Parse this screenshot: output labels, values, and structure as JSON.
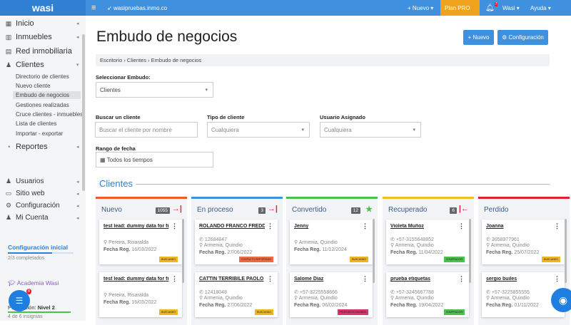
{
  "topbar": {
    "logo": "wasi",
    "menu_icon": "hamburger-icon",
    "site": "wasipruebas.inmo.co",
    "nuevo": "+ Nuevo ▾",
    "plan": "Plan PRO",
    "notif_count": "7",
    "user": "Wasi ▾",
    "help": "Ayuda ▾"
  },
  "sidebar": {
    "items": [
      {
        "label": "Inicio",
        "icon": "▦"
      },
      {
        "label": "Inmuebles",
        "icon": "▥"
      },
      {
        "label": "Red inmobiliaria",
        "icon": "▤"
      },
      {
        "label": "Clientes",
        "icon": "👥"
      }
    ],
    "sub": [
      "Directorio de clientes",
      "Nuevo cliente",
      "Embudo de negocios",
      "Gestiones realizadas",
      "Cruce clientes - inmuebles",
      "Lista de clientes",
      "Importar - exportar"
    ],
    "reportes": "Reportes",
    "bottom": [
      "Usuarios",
      "Sitio web",
      "Configuración",
      "Mi Cuenta"
    ],
    "config_title": "Configuración inicial",
    "config_progress": 0.67,
    "config_sub": "2/3 completados",
    "academia": "Academia Wasi",
    "level_prefix": "Puntuación:",
    "level": "Nivel 2",
    "badges": "4 de 6 insignias",
    "chat_badge": "8"
  },
  "main": {
    "title": "Embudo de negocios",
    "new_btn": "+ Nuevo",
    "config_btn": "⚙ Configuración",
    "breadcrumb": "Escritorio › Clientes › Embudo de negocios",
    "funnel_label": "Seleccionar Embudo:",
    "funnel_value": "Clientes",
    "search_label": "Buscar un cliente",
    "search_ph": "Buscar el cliente por nombre",
    "type_label": "Tipo de cliente",
    "type_value": "Cualquiera",
    "user_label": "Usuario Asignado",
    "user_value": "Cualquiera",
    "date_label": "Rango de fecha",
    "date_value": "Todos los tiempos",
    "section": "Clientes"
  },
  "columns": [
    {
      "name": "Nuevo",
      "count": "1055",
      "icon": "→|",
      "color": "#f05a28",
      "cards": [
        {
          "name": "test lead: dummy data for fi",
          "phone": "",
          "city": "Pereira, Risaralda",
          "date": "16/03/2022",
          "tag": "BUSCANDO",
          "tagc": "#f0b420"
        },
        {
          "name": "test lead: dummy data for fi",
          "phone": "",
          "city": "Pereira, Risaralda",
          "date": "16/03/2022",
          "tag": "BUSCANDO",
          "tagc": "#f0b420"
        }
      ]
    },
    {
      "name": "En proceso",
      "count": "3",
      "icon": "→|",
      "color": "#3f91df",
      "cards": [
        {
          "name": "ROLANDO FRANCO FREDDY",
          "phone": "12684847",
          "city": "Armenia, Quindio",
          "date": "27/06/2022",
          "tag": "CONTACTO REPORTADO",
          "tagc": "#f06a40"
        },
        {
          "name": "CATTIN TERRIBILE PAOLO",
          "phone": "12418048",
          "city": "Armenia, Quindio",
          "date": "27/06/2022",
          "tag": "BUSCANDO",
          "tagc": "#f0b420"
        }
      ]
    },
    {
      "name": "Convertido",
      "count": "12",
      "icon": "★",
      "color": "#4cc04c",
      "cards": [
        {
          "name": "Jenny",
          "phone": "",
          "city": "Armenia, Quindio",
          "date": "11/12/2024",
          "tag": "BUSCANDO",
          "tagc": "#f0b420"
        },
        {
          "name": "Salome Díaz",
          "phone": "+57-3225558666",
          "city": "Armenia, Quindio",
          "date": "06/02/2024",
          "tag": "PROPUESTA ENVIADA",
          "tagc": "#d8336a"
        }
      ]
    },
    {
      "name": "Recuperado",
      "count": "6",
      "icon": "|←",
      "color": "#f0c020",
      "cards": [
        {
          "name": "Violeta Muñoz",
          "phone": "+57-3155648852",
          "city": "Armenia, Quindio",
          "date": "11/04/2022",
          "tag": "COMPRADOR",
          "tagc": "#4cc04c"
        },
        {
          "name": "prueba etiquetas",
          "phone": "+57-3245667788",
          "city": "Armenia, Quindio",
          "date": "19/04/2022",
          "tag": "COMPRADOR",
          "tagc": "#4cc04c"
        }
      ]
    },
    {
      "name": "Perdido",
      "count": "",
      "icon": "",
      "color": "#e02030",
      "cards": [
        {
          "name": "Joanna",
          "phone": "3058977961",
          "city": "Armenia, Quindio",
          "date": "25/07/2022",
          "tag": "BUSCANDO",
          "tagc": "#f0b420"
        },
        {
          "name": "sergio builes",
          "phone": "+57-3225855555",
          "city": "Armenia, Quindio",
          "date": "01/11/2022",
          "tag": "",
          "tagc": "#f0b420"
        }
      ]
    }
  ],
  "date_prefix": "Fecha Reg."
}
